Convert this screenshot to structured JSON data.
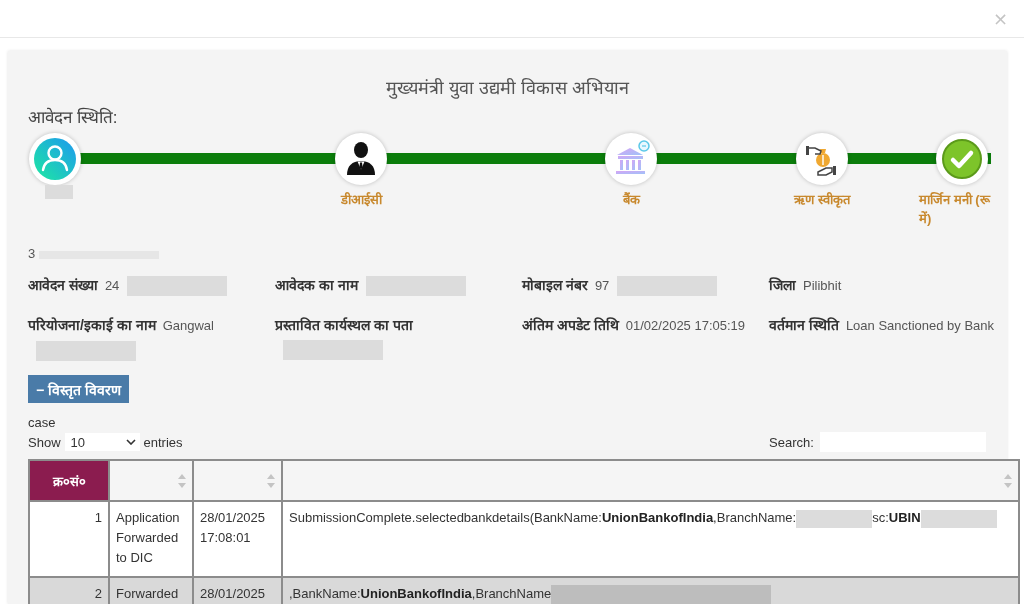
{
  "dialog": {
    "close": "×"
  },
  "title": "मुख्यमंत्री युवा उद्यमी विकास अभियान",
  "status_heading": "आवेदन स्थिति:",
  "steps": [
    {
      "kind": "applicant",
      "redacted": true,
      "completed": true
    },
    {
      "kind": "officer",
      "label": "डीआईसी",
      "redacted": false,
      "completed": true
    },
    {
      "kind": "bank",
      "label": "बैंक",
      "redacted": false,
      "completed": true
    },
    {
      "kind": "loan",
      "label": "ऋण स्वीकृत",
      "redacted": false,
      "completed": true
    },
    {
      "kind": "done",
      "label": "मार्जिन मनी (रू में)",
      "redacted": false,
      "completed": true
    }
  ],
  "reference": {
    "text": "3",
    "redacted": true
  },
  "details": [
    {
      "label": "आवेदन संख्या",
      "value": "24",
      "redacted": true
    },
    {
      "label": "आवेदक का नाम",
      "redacted": true
    },
    {
      "label": "मोबाइल नंबर",
      "value": "97",
      "redacted": true
    },
    {
      "label": "जिला",
      "value": "Pilibhit",
      "redacted": false
    },
    {
      "label": "परियोजना/इकाई का नाम",
      "value": "Gangwal",
      "redacted": true
    },
    {
      "label": "प्रस्तावित कार्यस्थल का पता",
      "redacted": true
    },
    {
      "label": "अंतिम अपडेट तिथि",
      "value": "01/02/2025 17:05:19",
      "redacted": false
    },
    {
      "label": "वर्तमान स्थिति",
      "value": "Loan Sanctioned by Bank",
      "redacted": false
    }
  ],
  "toggle_button": {
    "label": "− विस्तृत विवरण"
  },
  "table_caption": "case",
  "length_menu": {
    "before": "Show",
    "value": "10",
    "after": "entries"
  },
  "search": {
    "label": "Search:"
  },
  "table": {
    "columns": [
      {
        "label": "क्र०सं०",
        "highlighted": true,
        "sortable": false
      },
      {
        "highlighted": false,
        "sortable": true
      },
      {
        "highlighted": false,
        "sortable": true
      },
      {
        "highlighted": false,
        "sortable": true
      }
    ],
    "rows": [
      {
        "column_1": "1",
        "column_2": "Application Forwarded to DIC",
        "column_3": "28/01/2025 17:08:01",
        "column_4": [
          {
            "text": "SubmissionComplete.selectedbankdetails(BankName:**UnionBankofIndia**,BranchName:",
            "redacted": true
          },
          {
            "text": "sc:**UBIN**",
            "redacted": true
          }
        ]
      },
      {
        "column_1": "2",
        "column_2": "Forwarded",
        "column_3": "28/01/2025",
        "column_4": [
          {
            "text": ",BankName:**UnionBankofIndia**,BranchName",
            "redacted": true
          }
        ]
      }
    ]
  }
}
